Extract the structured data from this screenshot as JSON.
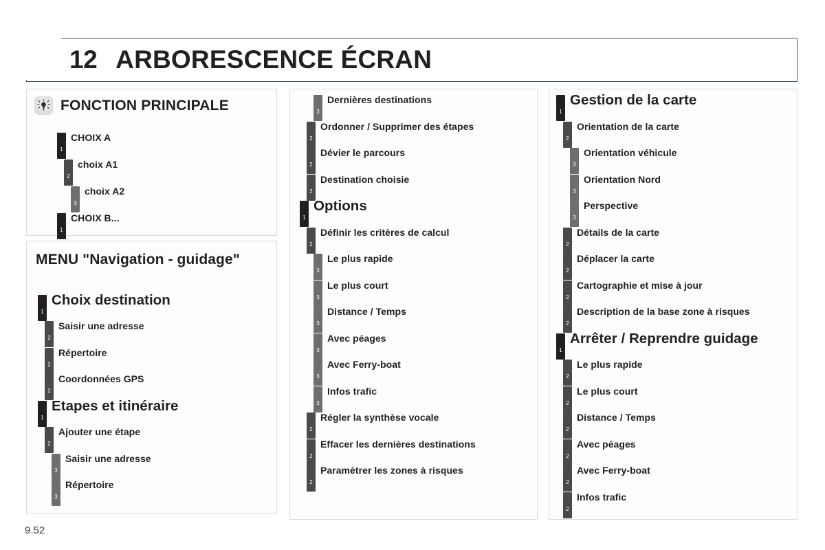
{
  "header": {
    "chapter_number": "12",
    "chapter_title": "ARBORESCENCE ÉCRAN",
    "border_color": "#3c4a63"
  },
  "colors": {
    "level_1": "#231f20",
    "level_2": "#4a4a4a",
    "level_3": "#6e6e6e",
    "panel_border": "#dcdcdc"
  },
  "panels": {
    "fonction_principale": {
      "icon": "bulb-icon",
      "title": "FONCTION PRINCIPALE",
      "items": [
        {
          "level": "1",
          "label": "CHOIX A",
          "size": "medium"
        },
        {
          "level": "2",
          "label": "choix A1",
          "size": "medium"
        },
        {
          "level": "3",
          "label": "choix A2",
          "size": "medium"
        },
        {
          "level": "1",
          "label": "CHOIX B...",
          "size": "medium"
        }
      ]
    },
    "menu_navigation": {
      "title": "MENU \"Navigation - guidage\"",
      "items": [
        {
          "level": "1",
          "label": "Choix destination",
          "size": "big"
        },
        {
          "level": "2",
          "label": "Saisir une adresse",
          "size": "medium"
        },
        {
          "level": "2",
          "label": "Répertoire",
          "size": "medium"
        },
        {
          "level": "2",
          "label": "Coordonnées GPS",
          "size": "medium"
        },
        {
          "level": "1",
          "label": "Etapes et itinéraire",
          "size": "big"
        },
        {
          "level": "2",
          "label": "Ajouter une étape",
          "size": "medium"
        },
        {
          "level": "3",
          "label": "Saisir une adresse",
          "size": "medium"
        },
        {
          "level": "3",
          "label": "Répertoire",
          "size": "medium"
        }
      ]
    },
    "middle": {
      "items": [
        {
          "level": "3",
          "label": "Dernières destinations",
          "size": "medium"
        },
        {
          "level": "2",
          "label": "Ordonner / Supprimer des étapes",
          "size": "medium"
        },
        {
          "level": "2",
          "label": "Dévier le parcours",
          "size": "medium"
        },
        {
          "level": "2",
          "label": "Destination choisie",
          "size": "medium"
        },
        {
          "level": "1",
          "label": "Options",
          "size": "big"
        },
        {
          "level": "2",
          "label": "Définir les critères de calcul",
          "size": "medium"
        },
        {
          "level": "3",
          "label": "Le plus rapide",
          "size": "medium"
        },
        {
          "level": "3",
          "label": "Le plus court",
          "size": "medium"
        },
        {
          "level": "3",
          "label": "Distance / Temps",
          "size": "medium"
        },
        {
          "level": "3",
          "label": "Avec péages",
          "size": "medium"
        },
        {
          "level": "3",
          "label": "Avec Ferry-boat",
          "size": "medium"
        },
        {
          "level": "3",
          "label": "Infos trafic",
          "size": "medium"
        },
        {
          "level": "2",
          "label": "Régler la synthèse vocale",
          "size": "medium"
        },
        {
          "level": "2",
          "label": "Effacer les dernières destinations",
          "size": "medium"
        },
        {
          "level": "2",
          "label": "Paramètrer les zones à risques",
          "size": "medium"
        }
      ]
    },
    "right": {
      "items": [
        {
          "level": "1",
          "label": "Gestion de la carte",
          "size": "big"
        },
        {
          "level": "2",
          "label": "Orientation de la carte",
          "size": "medium"
        },
        {
          "level": "3",
          "label": "Orientation véhicule",
          "size": "medium"
        },
        {
          "level": "3",
          "label": "Orientation Nord",
          "size": "medium"
        },
        {
          "level": "3",
          "label": "Perspective",
          "size": "medium"
        },
        {
          "level": "2",
          "label": "Détails de la carte",
          "size": "medium"
        },
        {
          "level": "2",
          "label": "Déplacer la carte",
          "size": "medium"
        },
        {
          "level": "2",
          "label": "Cartographie et mise à jour",
          "size": "medium"
        },
        {
          "level": "2",
          "label": "Description de la base zone à risques",
          "size": "medium"
        },
        {
          "level": "1",
          "label": "Arrêter / Reprendre guidage",
          "size": "big"
        },
        {
          "level": "2",
          "label": "Le plus rapide",
          "size": "medium"
        },
        {
          "level": "2",
          "label": "Le plus court",
          "size": "medium"
        },
        {
          "level": "2",
          "label": "Distance / Temps",
          "size": "medium"
        },
        {
          "level": "2",
          "label": "Avec péages",
          "size": "medium"
        },
        {
          "level": "2",
          "label": "Avec Ferry-boat",
          "size": "medium"
        },
        {
          "level": "2",
          "label": "Infos trafic",
          "size": "medium"
        }
      ]
    }
  },
  "footer": {
    "page_number": "9.52"
  }
}
